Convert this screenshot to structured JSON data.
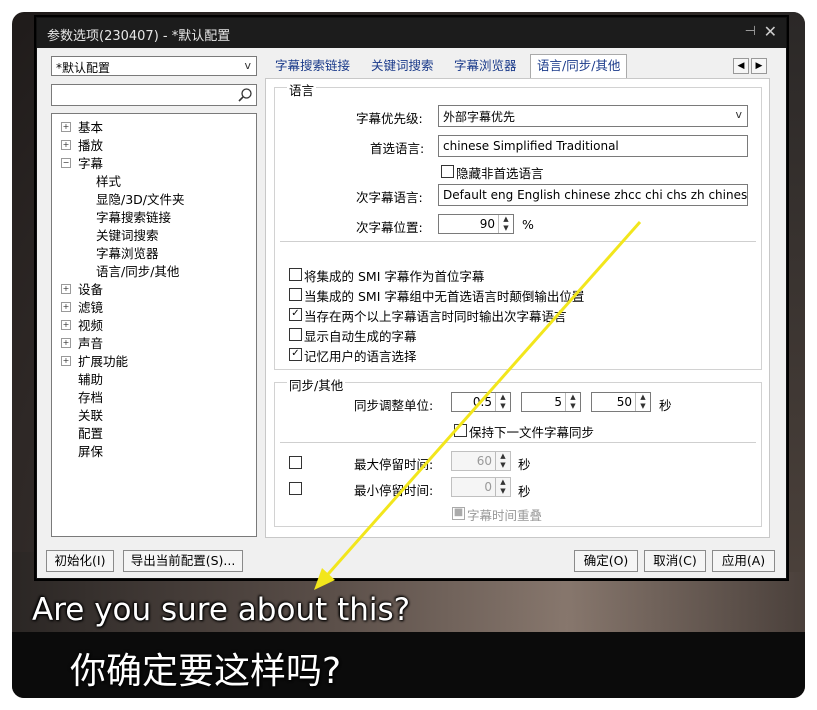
{
  "window": {
    "title": "参数选项(230407) - *默认配置"
  },
  "profile_combo": "*默认配置",
  "tree": {
    "items": [
      {
        "label": "基本",
        "expander": "+"
      },
      {
        "label": "播放",
        "expander": "+"
      },
      {
        "label": "字幕",
        "expander": "−"
      },
      {
        "label": "样式"
      },
      {
        "label": "显隐/3D/文件夹"
      },
      {
        "label": "字幕搜索链接"
      },
      {
        "label": "关键词搜索"
      },
      {
        "label": "字幕浏览器"
      },
      {
        "label": "语言/同步/其他"
      },
      {
        "label": "设备",
        "expander": "+"
      },
      {
        "label": "滤镜",
        "expander": "+"
      },
      {
        "label": "视频",
        "expander": "+"
      },
      {
        "label": "声音",
        "expander": "+"
      },
      {
        "label": "扩展功能",
        "expander": "+"
      },
      {
        "label": "辅助"
      },
      {
        "label": "存档"
      },
      {
        "label": "关联"
      },
      {
        "label": "配置"
      },
      {
        "label": "屏保"
      }
    ]
  },
  "tabs": [
    "字幕搜索链接",
    "关键词搜索",
    "字幕浏览器",
    "语言/同步/其他"
  ],
  "language": {
    "group_title": "语言",
    "priority_label": "字幕优先级:",
    "priority_value": "外部字幕优先",
    "pref_label": "首选语言:",
    "pref_value": "chinese Simplified Traditional",
    "hide_label": "隐藏非首选语言",
    "secondary_label": "次字幕语言:",
    "secondary_value": "Default eng English chinese zhcc chi chs zh chinese",
    "position_label": "次字幕位置:",
    "position_value": "90",
    "position_unit": "%",
    "options": [
      {
        "label": "将集成的 SMI 字幕作为首位字幕",
        "checked": false
      },
      {
        "label": "当集成的 SMI 字幕组中无首选语言时颠倒输出位置",
        "checked": false
      },
      {
        "label": "当存在两个以上字幕语言时同时输出次字幕语言",
        "checked": true
      },
      {
        "label": "显示自动生成的字幕",
        "checked": false
      },
      {
        "label": "记忆用户的语言选择",
        "checked": true
      }
    ]
  },
  "sync": {
    "group_title": "同步/其他",
    "unit_label": "同步调整单位:",
    "val1": "0.5",
    "val2": "5",
    "val3": "50",
    "unit": "秒",
    "keep_label": "保持下一文件字幕同步",
    "max_label": "最大停留时间:",
    "max_value": "60",
    "min_label": "最小停留时间:",
    "min_value": "0",
    "sec": "秒",
    "overlap_label": "字幕时间重叠"
  },
  "buttons": {
    "init": "初始化(I)",
    "export": "导出当前配置(S)...",
    "ok": "确定(O)",
    "cancel": "取消(C)",
    "apply": "应用(A)"
  },
  "subtitles": {
    "english": "Are you sure about this?",
    "chinese": "你确定要这样吗?"
  },
  "colors": {
    "title_bar": "#1c1c1c",
    "annotation_arrow": "#f2e61c",
    "tab_text": "#1a3a8a"
  }
}
